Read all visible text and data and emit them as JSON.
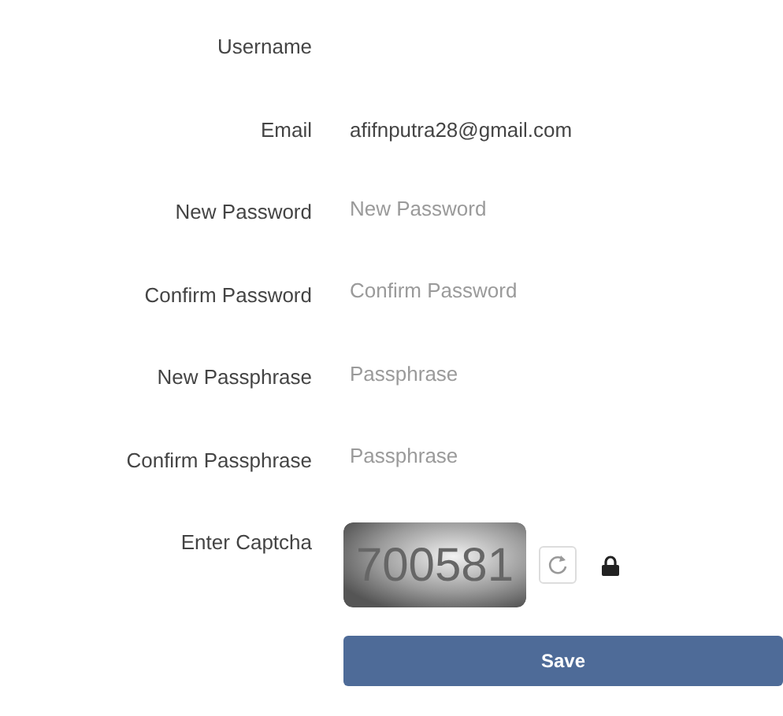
{
  "fields": [
    {
      "label": "Username",
      "kind": "text"
    },
    {
      "label": "Email",
      "kind": "text",
      "value": "afifnputra28@gmail.com"
    },
    {
      "label": "New Password",
      "kind": "input",
      "placeholder": "New Password"
    },
    {
      "label": "Confirm Password",
      "kind": "input",
      "placeholder": "Confirm Password"
    },
    {
      "label": "New Passphrase",
      "kind": "input",
      "placeholder": "Passphrase"
    },
    {
      "label": "Confirm Passphrase",
      "kind": "input",
      "placeholder": "Passphrase"
    }
  ],
  "captcha": {
    "label": "Enter Captcha",
    "code": "700581"
  },
  "save_button": "Save"
}
